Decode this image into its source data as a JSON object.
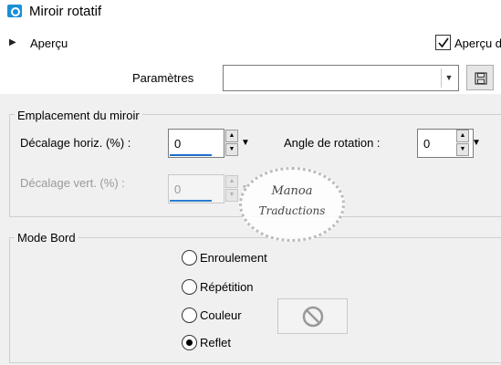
{
  "window": {
    "title": "Miroir rotatif",
    "icon": "camera-icon"
  },
  "preview": {
    "expander_icon": "triangle-right-icon",
    "label": "Aperçu",
    "checkbox_label": "Aperçu d",
    "checkbox_checked": true
  },
  "params": {
    "label": "Paramètres",
    "value": "",
    "save_icon": "save-icon"
  },
  "mirror_group": {
    "title": "Emplacement du miroir",
    "horiz_label": "Décalage horiz. (%) :",
    "horiz_value": "0",
    "rotation_label": "Angle de rotation :",
    "rotation_value": "0",
    "vert_label": "Décalage vert. (%) :",
    "vert_value": "0"
  },
  "edge_group": {
    "title": "Mode Bord",
    "options": [
      {
        "label": "Enroulement",
        "checked": false
      },
      {
        "label": "Répétition",
        "checked": false
      },
      {
        "label": "Couleur",
        "checked": false
      },
      {
        "label": "Reflet",
        "checked": true
      }
    ],
    "color_icon": "no-entry-icon"
  },
  "watermark": {
    "line1": "Manoa",
    "line2": "Traductions"
  },
  "colors": {
    "accent": "#1e6fc7",
    "title_icon": "#1a8fd6",
    "background": "#f0f0f0"
  }
}
